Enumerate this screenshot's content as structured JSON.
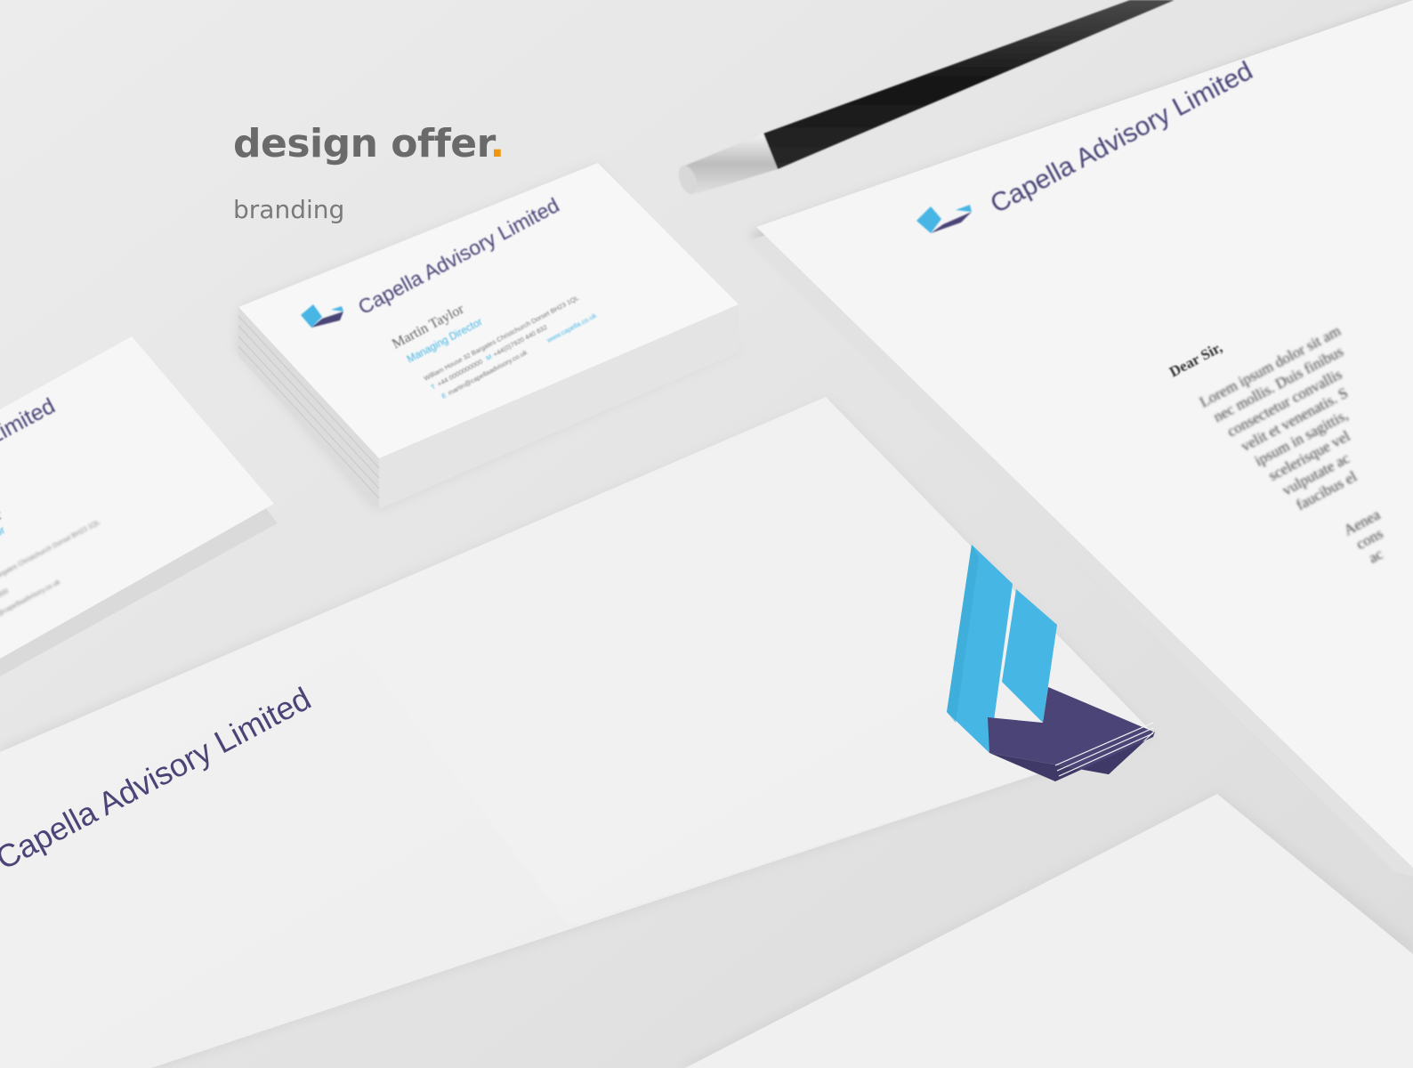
{
  "heading": {
    "text": "design offer",
    "dot": "."
  },
  "subheading": "branding",
  "brand": {
    "company_name": "Capella Advisory Limited"
  },
  "business_card": {
    "name": "Martin Taylor",
    "title": "Managing Director",
    "address": "William House 32 Bargates Christchurch Dorset BH23 1QL",
    "phone_label": "T",
    "phone": "+44 0000000000",
    "mobile_label": "M",
    "mobile": "+44(0)7920 440 832",
    "website": "www.capella.co.uk",
    "email_label": "E",
    "email": "martin@capellaadvisory.co.uk"
  },
  "letter": {
    "salutation": "Dear Sir,",
    "lines": [
      "Lorem ipsum dolor sit am",
      "nec mollis. Duis finibus",
      "consectetur convallis",
      "velit et venenatis. S",
      "ipsum in sagittis,",
      "scelerisque vel",
      "vulputate ac",
      "faucibus el"
    ],
    "lines2": [
      "Aenea",
      "cons",
      "ac"
    ]
  },
  "colors": {
    "background": "#e4e4e4",
    "paper": "#f4f4f4",
    "brand_blue": "#46b6e4",
    "brand_navy": "#4a4477",
    "heading_gray": "#6a6a6a",
    "accent_orange": "#f0960f",
    "pencil": "#1e1e1e"
  }
}
